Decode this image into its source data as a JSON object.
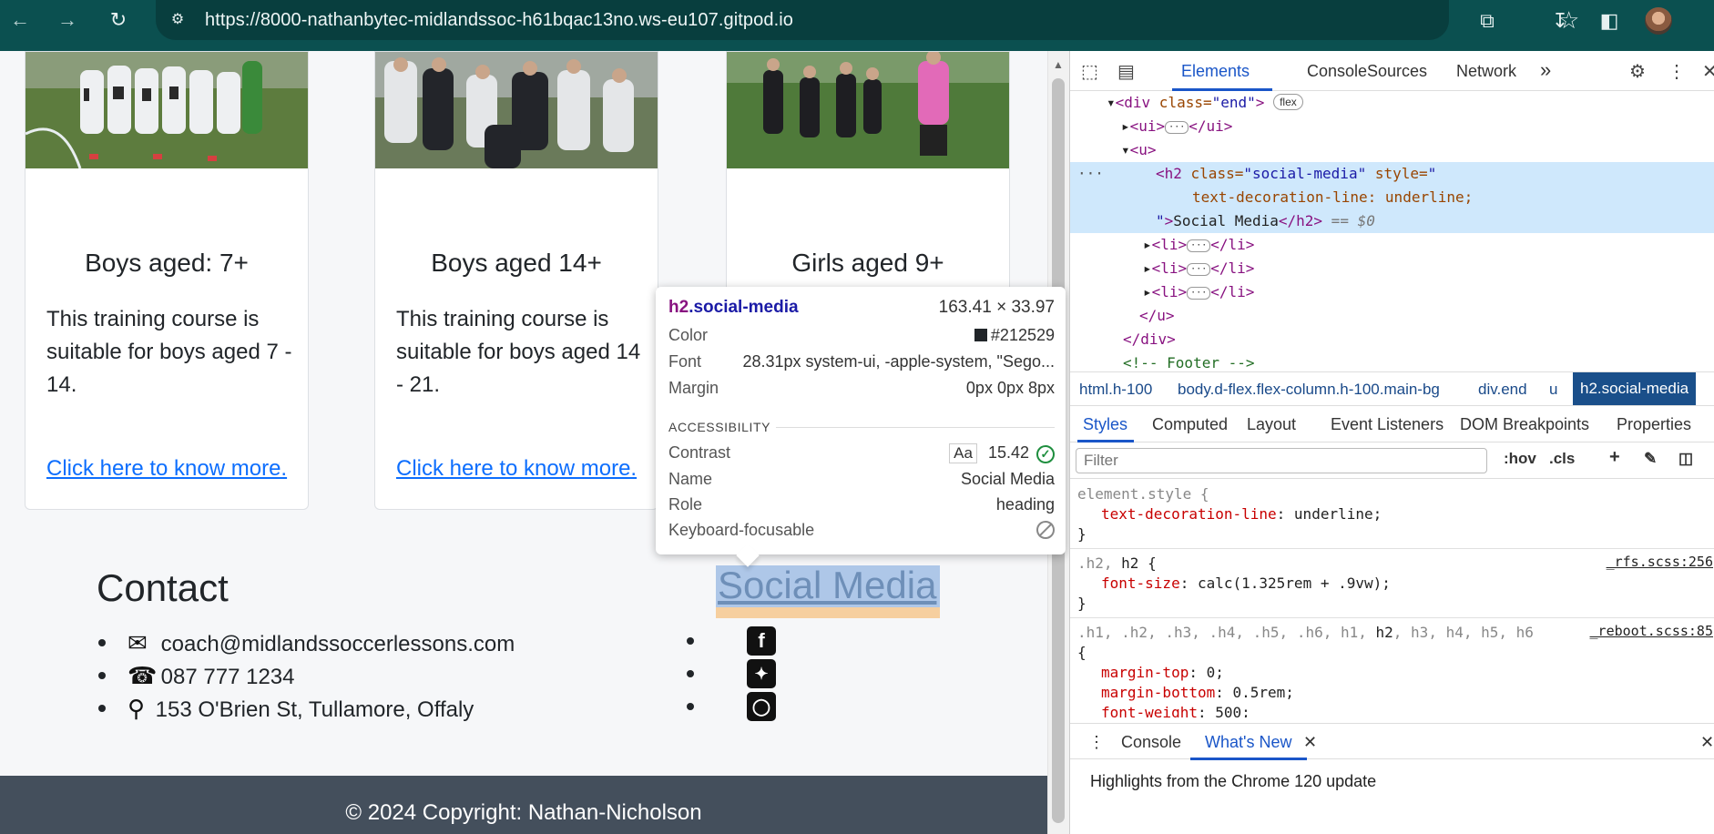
{
  "browser": {
    "url": "https://8000-nathanbytec-midlandssoc-h61bqac13no.ws-eu107.gitpod.io",
    "icons": [
      "back-arrow-icon",
      "forward-arrow-icon",
      "reload-icon",
      "site-settings-icon",
      "star-icon",
      "extensions-icon",
      "download-icon",
      "side-panel-icon",
      "profile-avatar"
    ]
  },
  "page": {
    "cards": [
      {
        "title": "Boys aged: 7+",
        "text": "This training course is suitable for boys aged 7 - 14.",
        "link": "Click here to know more."
      },
      {
        "title": "Boys aged 14+",
        "text": "This training course is suitable for boys aged 14 - 21.",
        "link": "Click here to know more."
      },
      {
        "title": "Girls aged 9+",
        "text": "",
        "link": ""
      }
    ],
    "contact": {
      "title": "Contact",
      "items": [
        {
          "icon": "envelope-icon",
          "text": "coach@midlandssoccerlessons.com"
        },
        {
          "icon": "phone-icon",
          "text": "087 777 1234"
        },
        {
          "icon": "location-pin-icon",
          "text": "153 O'Brien St, Tullamore, Offaly"
        }
      ]
    },
    "social": {
      "title": "Social Media",
      "items": [
        "facebook-icon",
        "twitter-icon",
        "instagram-icon"
      ]
    },
    "footer": "© 2024 Copyright: Nathan-Nicholson"
  },
  "tooltip": {
    "selector_tag": "h2",
    "selector_class": ".social-media",
    "size": "163.41 × 33.97",
    "color_label": "Color",
    "color_value": "#212529",
    "font_label": "Font",
    "font_value": "28.31px system-ui, -apple-system, \"Sego...",
    "margin_label": "Margin",
    "margin_value": "0px 0px 8px",
    "section": "ACCESSIBILITY",
    "contrast_label": "Contrast",
    "contrast_aa": "Aa",
    "contrast_value": "15.42",
    "name_label": "Name",
    "name_value": "Social Media",
    "role_label": "Role",
    "role_value": "heading",
    "focus_label": "Keyboard-focusable"
  },
  "devtools": {
    "tabs": [
      "Elements",
      "Console",
      "Sources",
      "Network"
    ],
    "active_tab": "Elements",
    "more": "»",
    "dom": {
      "l1_tag_open": "<div",
      "l1_attr": " class=",
      "l1_val": "\"end\"",
      "l1_close": ">",
      "l1_badge": "flex",
      "l2": "<ui>",
      "l2_end": "</ui>",
      "l3": "<u>",
      "l4_tag": "<h2",
      "l4_attr1": " class=",
      "l4_val1": "\"social-media\"",
      "l4_attr2": " style=",
      "l4_val2": "\"",
      "l5": "text-decoration-line: underline;",
      "l6_q": "\"",
      "l6_gt": ">",
      "l6_text": "Social Media",
      "l6_end": "</h2>",
      "l6_eq": " == $0",
      "li_open": "<li>",
      "li_close": "</li>",
      "l10": "</u>",
      "l11": "</div>",
      "l12": "<!-- Footer -->"
    },
    "breadcrumbs": [
      "html.h-100",
      "body.d-flex.flex-column.h-100.main-bg",
      "div.end",
      "u",
      "h2.social-media"
    ],
    "subtabs": [
      "Styles",
      "Computed",
      "Layout",
      "Event Listeners",
      "DOM Breakpoints",
      "Properties"
    ],
    "filter_placeholder": "Filter",
    "hov": ":hov",
    "cls": ".cls",
    "rules": {
      "r1_sel": "element.style {",
      "r1_prop": "text-decoration-line",
      "r1_val": ": underline;",
      "close": "}",
      "r2_sel_dim": ".h2, ",
      "r2_sel": "h2 {",
      "r2_src": "_rfs.scss:256",
      "r2_prop": "font-size",
      "r2_val": ": calc(1.325rem + .9vw);",
      "r3_sel_dim": ".h1, .h2, .h3, .h4, .h5, .h6, h1, ",
      "r3_sel_h2": "h2",
      "r3_sel_rest": ", h3, h4, h5, h6",
      "r3_src": "_reboot.scss:85",
      "r3_open": "{",
      "r3_p1": "margin-top",
      "r3_v1": ": 0;",
      "r3_p2": "margin-bottom",
      "r3_v2": ": 0.5rem;",
      "r3_p3": "font-weight",
      "r3_v3": ": 500;"
    },
    "drawer_tabs": [
      "Console",
      "What's New"
    ],
    "drawer_active": "What's New",
    "drawer_text": "Highlights from the Chrome 120 update"
  },
  "colors": {
    "chrome": "#0b5050",
    "link": "#0d6efd",
    "text": "#212529",
    "footer": "#444f5c",
    "devtools_accent": "#1a56c8"
  }
}
